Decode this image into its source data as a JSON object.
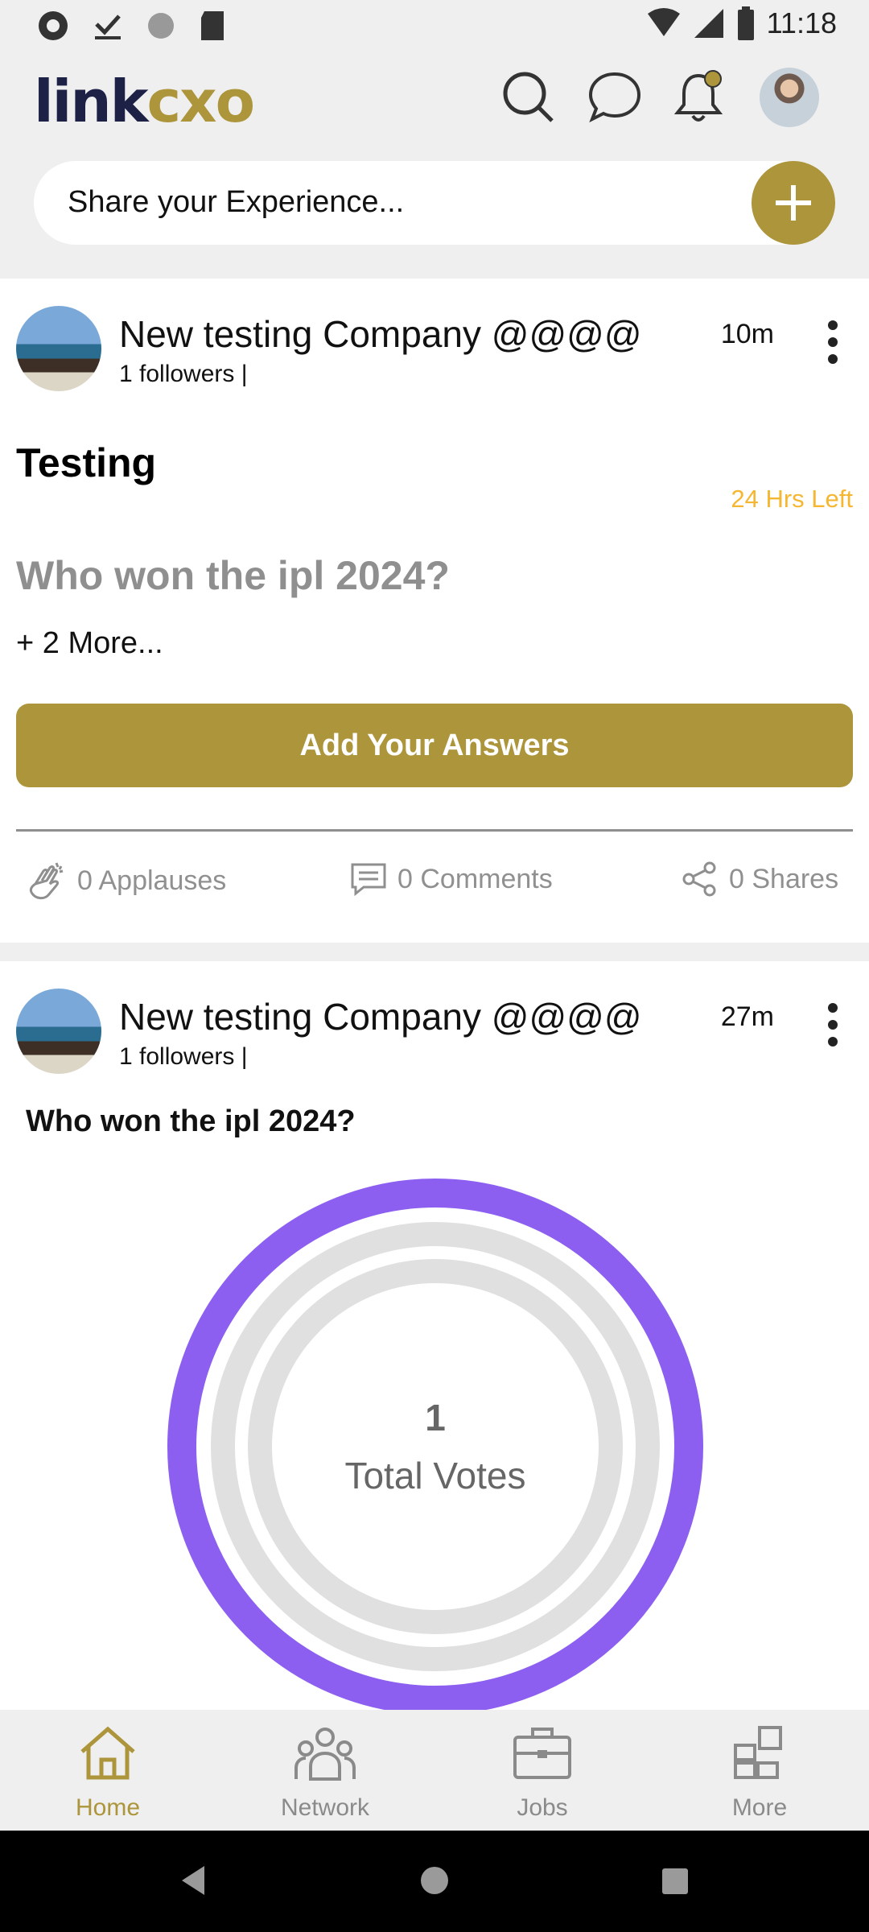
{
  "status_bar": {
    "time": "11:18"
  },
  "header": {
    "logo_part1": "link",
    "logo_part2": "cxo"
  },
  "share": {
    "placeholder": "Share your Experience..."
  },
  "post1": {
    "company": "New testing Company @@@@",
    "followers": "1 followers |",
    "time": "10m",
    "title": "Testing",
    "time_left": "24 Hrs Left",
    "question": "Who won the ipl 2024?",
    "more": "+ 2 More...",
    "button": "Add Your Answers",
    "applauses": "0 Applauses",
    "comments": "0 Comments",
    "shares": "0 Shares"
  },
  "post2": {
    "company": "New testing Company @@@@",
    "followers": "1 followers |",
    "time": "27m",
    "question": "Who won the ipl 2024?",
    "total_count": "1",
    "total_label": "Total Votes",
    "ring_color": "#8c5ff0",
    "empty_color": "#e0e0e0"
  },
  "nav": {
    "items": [
      {
        "label": "Home",
        "icon": "home-icon",
        "active": true
      },
      {
        "label": "Network",
        "icon": "network-icon",
        "active": false
      },
      {
        "label": "Jobs",
        "icon": "briefcase-icon",
        "active": false
      },
      {
        "label": "More",
        "icon": "grid-icon",
        "active": false
      }
    ]
  },
  "colors": {
    "brand": "#ad953b",
    "warning": "#f5b731",
    "navy": "#1c2145"
  }
}
